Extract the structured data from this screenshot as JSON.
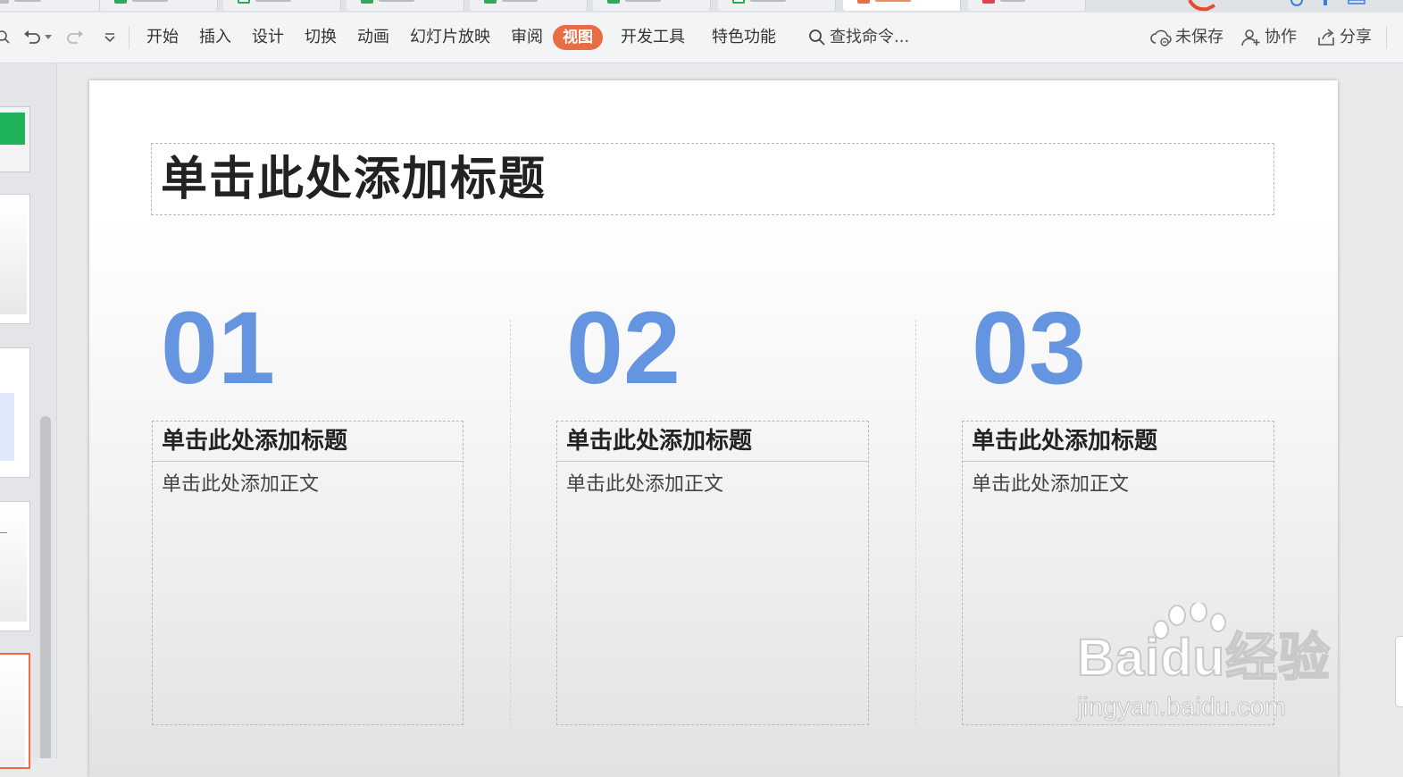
{
  "ribbon": {
    "menus": [
      "开始",
      "插入",
      "设计",
      "切换",
      "动画",
      "幻灯片放映",
      "审阅",
      "视图",
      "开发工具",
      "特色功能"
    ],
    "active_menu": "视图",
    "search_label": "查找命令...",
    "unsaved_label": "未保存",
    "collab_label": "协作",
    "share_label": "分享"
  },
  "slide": {
    "title": "单击此处添加标题",
    "columns": [
      {
        "number": "01",
        "title": "单击此处添加标题",
        "body": "单击此处添加正文"
      },
      {
        "number": "02",
        "title": "单击此处添加标题",
        "body": "单击此处添加正文"
      },
      {
        "number": "03",
        "title": "单击此处添加标题",
        "body": "单击此处添加正文"
      }
    ]
  },
  "watermark": {
    "brand": "Baidu经验",
    "url": "jingyan.baidu.com"
  },
  "colors": {
    "accent": "#ea6c43",
    "number_blue": "#6595e0"
  }
}
